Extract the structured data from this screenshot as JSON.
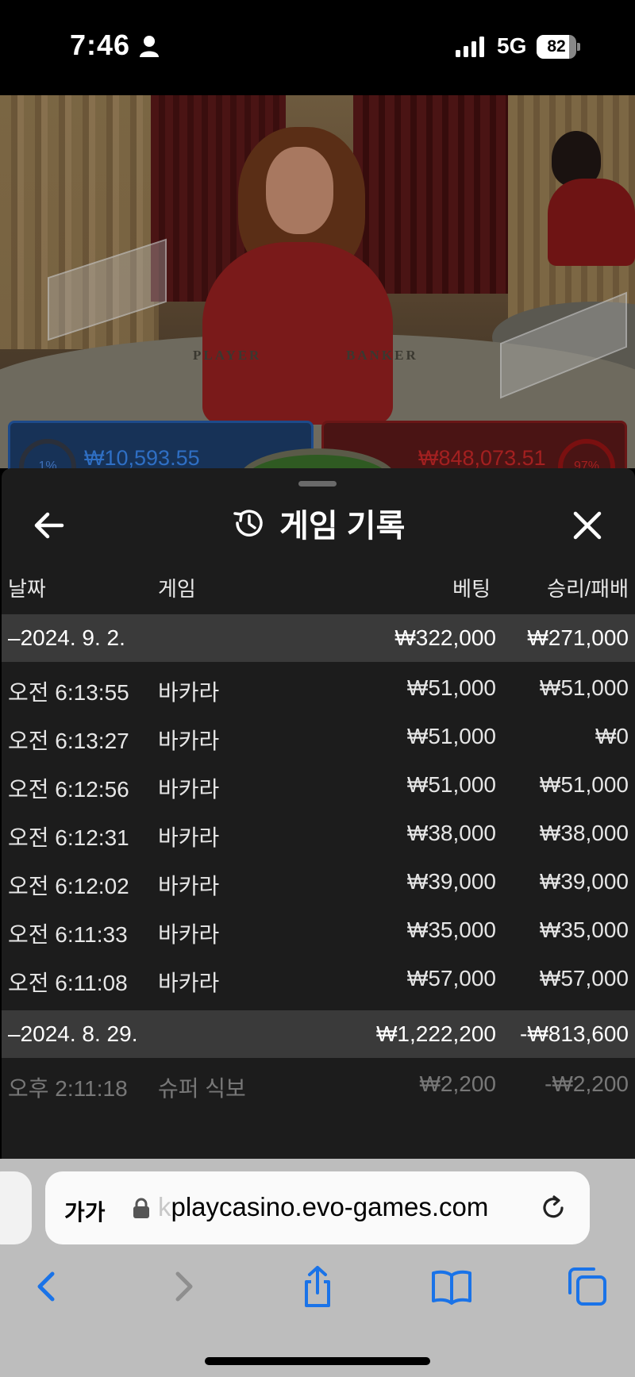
{
  "status_bar": {
    "time": "7:46",
    "network": "5G",
    "battery_level": "82",
    "battery_fraction": 0.82
  },
  "video": {
    "table_label_player": "PLAYER",
    "table_label_banker": "BANKER",
    "player_pot": "₩10,593.55",
    "banker_pot": "₩848,073.51",
    "player_percent": "1%",
    "banker_percent": "97%"
  },
  "sheet": {
    "title": "게임 기록",
    "icons": {
      "back": "arrow-left-icon",
      "history": "history-icon",
      "close": "close-icon"
    },
    "columns": {
      "date": "날짜",
      "game": "게임",
      "bet": "베팅",
      "result": "승리/패배"
    },
    "groups": [
      {
        "date": "–2024. 9. 2.",
        "bet": "₩322,000",
        "result": "₩271,000",
        "rows": [
          {
            "time": "오전 6:13:55",
            "game": "바카라",
            "bet": "₩51,000",
            "result": "₩51,000"
          },
          {
            "time": "오전 6:13:27",
            "game": "바카라",
            "bet": "₩51,000",
            "result": "₩0"
          },
          {
            "time": "오전 6:12:56",
            "game": "바카라",
            "bet": "₩51,000",
            "result": "₩51,000"
          },
          {
            "time": "오전 6:12:31",
            "game": "바카라",
            "bet": "₩38,000",
            "result": "₩38,000"
          },
          {
            "time": "오전 6:12:02",
            "game": "바카라",
            "bet": "₩39,000",
            "result": "₩39,000"
          },
          {
            "time": "오전 6:11:33",
            "game": "바카라",
            "bet": "₩35,000",
            "result": "₩35,000"
          },
          {
            "time": "오전 6:11:08",
            "game": "바카라",
            "bet": "₩57,000",
            "result": "₩57,000"
          }
        ]
      },
      {
        "date": "–2024. 8. 29.",
        "bet": "₩1,222,200",
        "result": "-₩813,600",
        "rows": [
          {
            "time": "오후 2:11:18",
            "game": "슈퍼 식보",
            "bet": "₩2,200",
            "result": "-₩2,200"
          }
        ]
      }
    ]
  },
  "safari": {
    "aa_label": "가가",
    "url_cut": "k",
    "url": "playcasino.evo-games.com",
    "colors": {
      "accent": "#1a73e8",
      "disabled": "#8e8e8e"
    }
  }
}
